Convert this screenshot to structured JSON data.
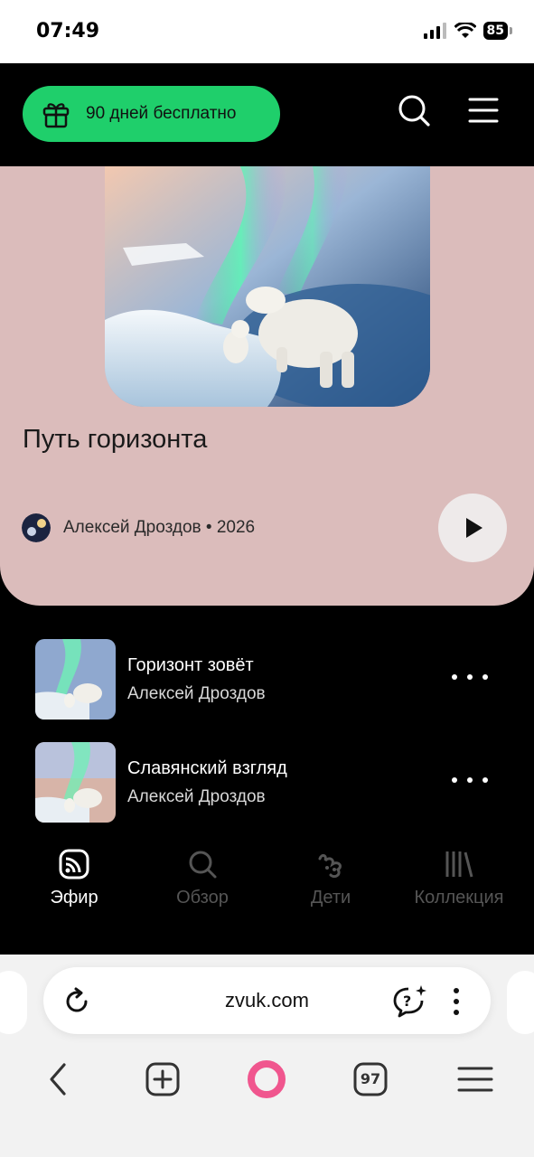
{
  "status": {
    "time": "07:49",
    "battery": "85"
  },
  "header": {
    "promo_label": "90 дней бесплатно",
    "icons": [
      "gift-icon",
      "search-icon",
      "menu-icon"
    ]
  },
  "hero": {
    "title": "Путь горизонта",
    "meta": "Алексей Дроздов • 2026",
    "play_icon": "play-icon"
  },
  "tracks": [
    {
      "title": "Горизонт зовёт",
      "artist": "Алексей Дроздов"
    },
    {
      "title": "Славянский взгляд",
      "artist": "Алексей Дроздов"
    }
  ],
  "tabs": [
    {
      "label": "Эфир",
      "icon": "broadcast-icon",
      "active": true
    },
    {
      "label": "Обзор",
      "icon": "search-icon",
      "active": false
    },
    {
      "label": "Дети",
      "icon": "kids-icon",
      "active": false
    },
    {
      "label": "Коллекция",
      "icon": "library-icon",
      "active": false
    }
  ],
  "browser": {
    "url": "zvuk.com",
    "tab_count": "97",
    "icons": [
      "reload-icon",
      "assistant-icon",
      "more-vertical-icon",
      "back-icon",
      "new-tab-icon",
      "alice-icon",
      "tabs-icon",
      "menu-icon"
    ]
  },
  "colors": {
    "promo": "#1fcf6b",
    "hero_bg": "#dbbcbb",
    "page_bg": "#000000",
    "alice": "#f0568e"
  }
}
